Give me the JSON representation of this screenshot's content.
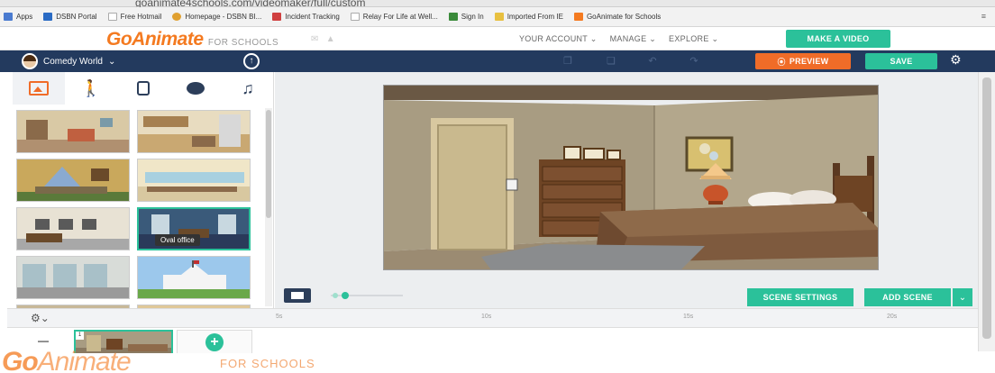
{
  "browser": {
    "url_fragment": "goanimate4schools.com/videomaker/full/custom",
    "bookmarks": [
      {
        "label": "Apps",
        "color": "#4a7bd0"
      },
      {
        "label": "DSBN Portal",
        "color": "#2a6bc4"
      },
      {
        "label": "Free Hotmail",
        "color": "#aaaaaa"
      },
      {
        "label": "Homepage - DSBN BI...",
        "color": "#e0a030"
      },
      {
        "label": "Incident Tracking",
        "color": "#d04040"
      },
      {
        "label": "Relay For Life at Well...",
        "color": "#aaaaaa"
      },
      {
        "label": "Sign In",
        "color": "#3a8a3a"
      },
      {
        "label": "Imported From IE",
        "color": "#e8c040"
      },
      {
        "label": "GoAnimate for Schools",
        "color": "#f47a20"
      }
    ]
  },
  "header": {
    "logo_main": "GoAnimate",
    "logo_sub": "FOR SCHOOLS",
    "nav": [
      "YOUR ACCOUNT ⌄",
      "MANAGE ⌄",
      "EXPLORE ⌄"
    ],
    "make_video": "MAKE A VIDEO"
  },
  "toolbar": {
    "theme": "Comedy World",
    "preview": "PREVIEW",
    "save": "SAVE"
  },
  "library": {
    "hover_tooltip": "Oval office"
  },
  "stage": {
    "scene_settings": "SCENE SETTINGS",
    "add_scene": "ADD SCENE"
  },
  "timeline": {
    "ticks": [
      "5s",
      "10s",
      "15s",
      "20s"
    ],
    "scene_number": "1"
  },
  "footer": {
    "logo_go": "Go",
    "logo_animate": "Animate",
    "logo_sub": "FOR SCHOOLS"
  },
  "colors": {
    "accent_green": "#2bc19a",
    "accent_orange": "#f06c28",
    "toolbar_navy": "#233a5e"
  }
}
